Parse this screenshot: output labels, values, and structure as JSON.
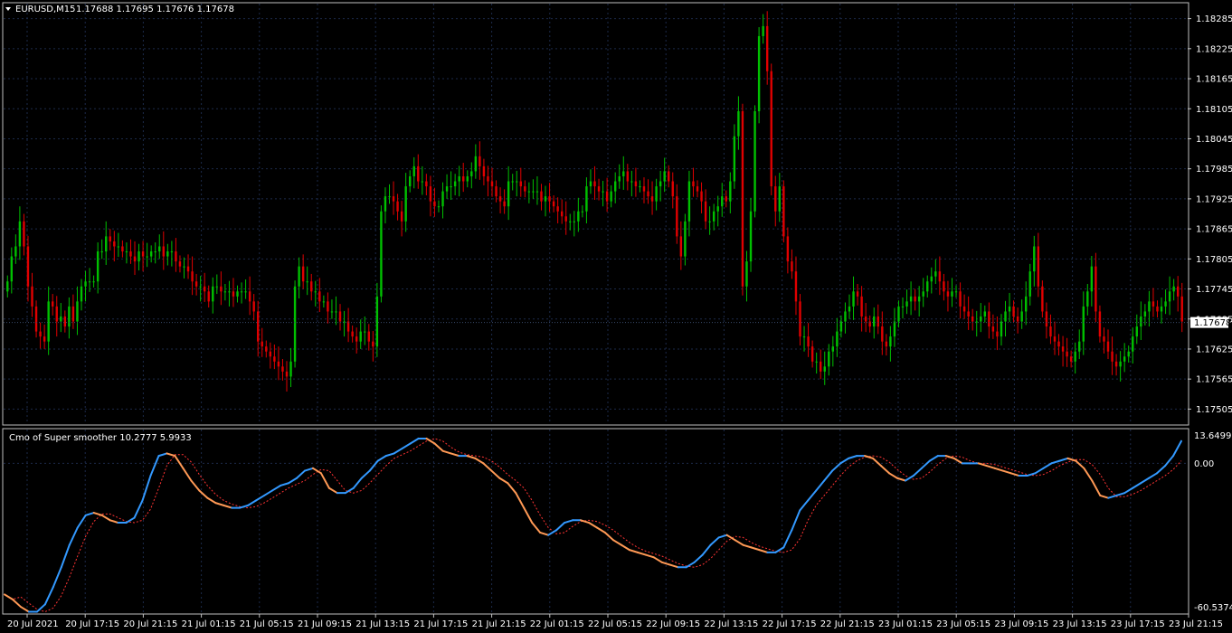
{
  "header": {
    "symbol_label": "EURUSD,M15",
    "ohlc_label": "1.17688 1.17695 1.17676 1.17678"
  },
  "indicator": {
    "label": "Cmo of Super smoother 10.2777 5.9933",
    "y_labels": [
      "13.6499",
      "0.00",
      "-60.5374"
    ]
  },
  "colors": {
    "background": "#000000",
    "frame": "#c0c0c0",
    "grid": "#1c2a4a",
    "bull": "#00c000",
    "bear": "#e00000",
    "cmo_up": "#3399ff",
    "cmo_down": "#ff9955",
    "signal": "#ff3333"
  },
  "chart_data": [
    {
      "type": "candlestick",
      "title": "EURUSD,M15",
      "ylim": [
        1.17475,
        1.18315
      ],
      "yticks": [
        "1.18285",
        "1.18225",
        "1.18165",
        "1.18105",
        "1.18045",
        "1.17985",
        "1.17925",
        "1.17865",
        "1.17805",
        "1.17745",
        "1.17685",
        "1.17625",
        "1.17565",
        "1.17505"
      ],
      "last_price": "1.17678",
      "xticks": [
        "20 Jul 2021",
        "20 Jul 17:15",
        "20 Jul 21:15",
        "21 Jul 01:15",
        "21 Jul 05:15",
        "21 Jul 09:15",
        "21 Jul 13:15",
        "21 Jul 17:15",
        "21 Jul 21:15",
        "22 Jul 01:15",
        "22 Jul 05:15",
        "22 Jul 09:15",
        "22 Jul 13:15",
        "22 Jul 17:15",
        "22 Jul 21:15",
        "23 Jul 01:15",
        "23 Jul 05:15",
        "23 Jul 09:15",
        "23 Jul 13:15",
        "23 Jul 17:15",
        "23 Jul 21:15"
      ],
      "close": [
        1.1776,
        1.1781,
        1.1783,
        1.1788,
        1.1783,
        1.1775,
        1.1771,
        1.1766,
        1.1765,
        1.1764,
        1.1772,
        1.1771,
        1.1768,
        1.1769,
        1.1767,
        1.1771,
        1.1768,
        1.1772,
        1.1775,
        1.1776,
        1.1776,
        1.1776,
        1.1782,
        1.1782,
        1.1785,
        1.1784,
        1.1783,
        1.1783,
        1.1782,
        1.1782,
        1.1781,
        1.178,
        1.1782,
        1.1781,
        1.1781,
        1.1782,
        1.1782,
        1.1783,
        1.1781,
        1.1782,
        1.1782,
        1.178,
        1.1779,
        1.1779,
        1.1778,
        1.1776,
        1.1775,
        1.1775,
        1.1774,
        1.1772,
        1.1775,
        1.1775,
        1.1774,
        1.1774,
        1.1774,
        1.1773,
        1.1774,
        1.1774,
        1.1774,
        1.1772,
        1.177,
        1.1764,
        1.1763,
        1.1762,
        1.1761,
        1.176,
        1.1759,
        1.1758,
        1.1757,
        1.176,
        1.1775,
        1.1779,
        1.1776,
        1.1776,
        1.1774,
        1.1774,
        1.1772,
        1.1772,
        1.177,
        1.177,
        1.177,
        1.1768,
        1.1768,
        1.1766,
        1.1765,
        1.1764,
        1.1766,
        1.1766,
        1.1764,
        1.1763,
        1.1773,
        1.179,
        1.1793,
        1.1793,
        1.1792,
        1.179,
        1.1788,
        1.1795,
        1.1797,
        1.1799,
        1.1796,
        1.1796,
        1.1795,
        1.1792,
        1.1791,
        1.1791,
        1.1794,
        1.1795,
        1.1795,
        1.1796,
        1.1797,
        1.1796,
        1.1797,
        1.1798,
        1.1801,
        1.1799,
        1.1797,
        1.1796,
        1.1795,
        1.1793,
        1.1792,
        1.1791,
        1.1796,
        1.1796,
        1.1796,
        1.1795,
        1.1794,
        1.1794,
        1.1794,
        1.1794,
        1.1792,
        1.1793,
        1.1792,
        1.1791,
        1.179,
        1.1789,
        1.1788,
        1.1788,
        1.1788,
        1.179,
        1.179,
        1.1795,
        1.1796,
        1.1795,
        1.1794,
        1.1794,
        1.1792,
        1.1794,
        1.1796,
        1.1797,
        1.1798,
        1.1796,
        1.1796,
        1.1795,
        1.1795,
        1.1794,
        1.1793,
        1.1792,
        1.1795,
        1.1796,
        1.1798,
        1.1796,
        1.1793,
        1.1785,
        1.1781,
        1.1788,
        1.1796,
        1.1795,
        1.1794,
        1.1792,
        1.1788,
        1.1788,
        1.179,
        1.1791,
        1.1793,
        1.1792,
        1.1796,
        1.1805,
        1.181,
        1.1775,
        1.178,
        1.179,
        1.181,
        1.1825,
        1.1827,
        1.1818,
        1.1795,
        1.179,
        1.1795,
        1.1785,
        1.178,
        1.1778,
        1.1772,
        1.1765,
        1.1765,
        1.1763,
        1.176,
        1.176,
        1.1758,
        1.1759,
        1.1762,
        1.1763,
        1.1766,
        1.1768,
        1.177,
        1.1771,
        1.1774,
        1.1773,
        1.1769,
        1.1768,
        1.1767,
        1.1769,
        1.1767,
        1.1764,
        1.1763,
        1.1765,
        1.1768,
        1.1771,
        1.1771,
        1.1772,
        1.1773,
        1.1772,
        1.1773,
        1.1774,
        1.1776,
        1.1777,
        1.1778,
        1.1776,
        1.1774,
        1.1773,
        1.1774,
        1.1774,
        1.1771,
        1.177,
        1.1769,
        1.1768,
        1.1768,
        1.1769,
        1.177,
        1.1767,
        1.1766,
        1.1765,
        1.1768,
        1.177,
        1.1771,
        1.1769,
        1.1768,
        1.177,
        1.1773,
        1.1778,
        1.1783,
        1.1775,
        1.177,
        1.1767,
        1.1765,
        1.1764,
        1.1763,
        1.1762,
        1.1761,
        1.176,
        1.1762,
        1.1764,
        1.1771,
        1.1774,
        1.1779,
        1.177,
        1.1765,
        1.1764,
        1.1762,
        1.176,
        1.1759,
        1.176,
        1.1761,
        1.1762,
        1.1765,
        1.1767,
        1.1769,
        1.177,
        1.1772,
        1.1771,
        1.177,
        1.1771,
        1.1772,
        1.1774,
        1.1775,
        1.1773,
        1.1768
      ],
      "note_ranges": "candles: open≈previous close, high/low≈close±small range"
    },
    {
      "type": "line",
      "title": "Cmo of Super smoother 10.2777 5.9933",
      "ylim": [
        -60.5374,
        13.6499
      ],
      "series": [
        {
          "values": [
            -53,
            -55,
            -58,
            -60,
            -60,
            -57,
            -50,
            -42,
            -33,
            -26,
            -21,
            -20,
            -21,
            -23,
            -24,
            -24,
            -22,
            -15,
            -5,
            3,
            4,
            3,
            -2,
            -7,
            -11,
            -14,
            -16,
            -17,
            -18,
            -18,
            -17,
            -15,
            -13,
            -11,
            -9,
            -8,
            -6,
            -3,
            -2,
            -4,
            -10,
            -12,
            -12,
            -10,
            -6,
            -3,
            1,
            3,
            4,
            6,
            8,
            10,
            10,
            8,
            5,
            4,
            3,
            3,
            2,
            0,
            -3,
            -6,
            -8,
            -12,
            -18,
            -24,
            -28,
            -29,
            -27,
            -24,
            -23,
            -23,
            -24,
            -26,
            -28,
            -31,
            -33,
            -35,
            -36,
            -37,
            -38,
            -40,
            -41,
            -42,
            -42,
            -40,
            -37,
            -33,
            -30,
            -29,
            -31,
            -33,
            -34,
            -35,
            -36,
            -36,
            -34,
            -27,
            -19,
            -15,
            -11,
            -7,
            -3,
            0,
            2,
            3,
            3,
            2,
            -1,
            -4,
            -6,
            -7,
            -5,
            -2,
            1,
            3,
            3,
            2,
            0,
            0,
            0,
            -1,
            -2,
            -3,
            -4,
            -5,
            -5,
            -4,
            -2,
            0,
            1,
            2,
            1,
            -2,
            -7,
            -13,
            -14,
            -13,
            -12,
            -10,
            -8,
            -6,
            -4,
            -1,
            3,
            9
          ]
        }
      ]
    }
  ]
}
